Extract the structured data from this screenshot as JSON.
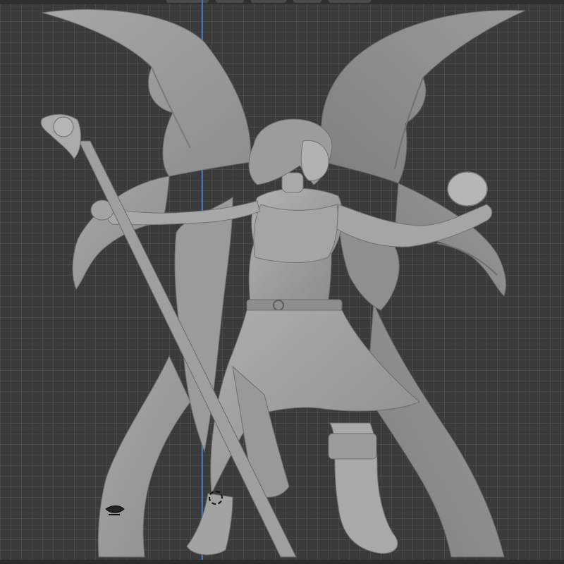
{
  "app": {
    "view": "3d-viewport",
    "grid": true
  },
  "scene": {
    "object": "fairy-sorceress-figurine-model",
    "shading": "solid",
    "colors": {
      "background": "#3b3b3b",
      "grid_line": "#4a4a4a",
      "model_surface": "#9e9e9e",
      "y_axis": "#4f7bd6"
    }
  },
  "icons": {
    "origin": "origin-cursor-icon",
    "light": "lamp-icon"
  }
}
